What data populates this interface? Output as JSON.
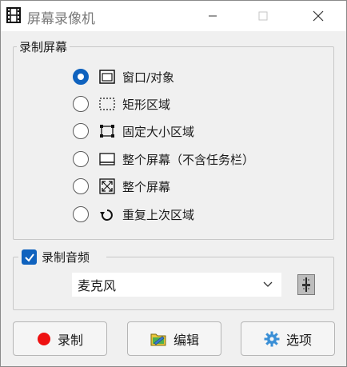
{
  "window": {
    "title": "屏幕录像机"
  },
  "capture_group": {
    "legend": "录制屏幕",
    "options": [
      {
        "label": "窗口/对象",
        "icon": "window-object-icon",
        "checked": true
      },
      {
        "label": "矩形区域",
        "icon": "dashed-rectangle-icon",
        "checked": false
      },
      {
        "label": "固定大小区域",
        "icon": "fixed-size-region-icon",
        "checked": false
      },
      {
        "label": "整个屏幕（不含任务栏）",
        "icon": "screen-without-taskbar-icon",
        "checked": false
      },
      {
        "label": "整个屏幕",
        "icon": "fullscreen-arrows-icon",
        "checked": false
      },
      {
        "label": "重复上次区域",
        "icon": "repeat-last-region-icon",
        "checked": false
      }
    ]
  },
  "audio_group": {
    "legend": "录制音频",
    "checked": true,
    "device": "麦克风"
  },
  "buttons": {
    "record": "录制",
    "edit": "编辑",
    "options": "选项"
  },
  "colors": {
    "accent": "#0f62be",
    "record_dot": "#ee1111"
  }
}
